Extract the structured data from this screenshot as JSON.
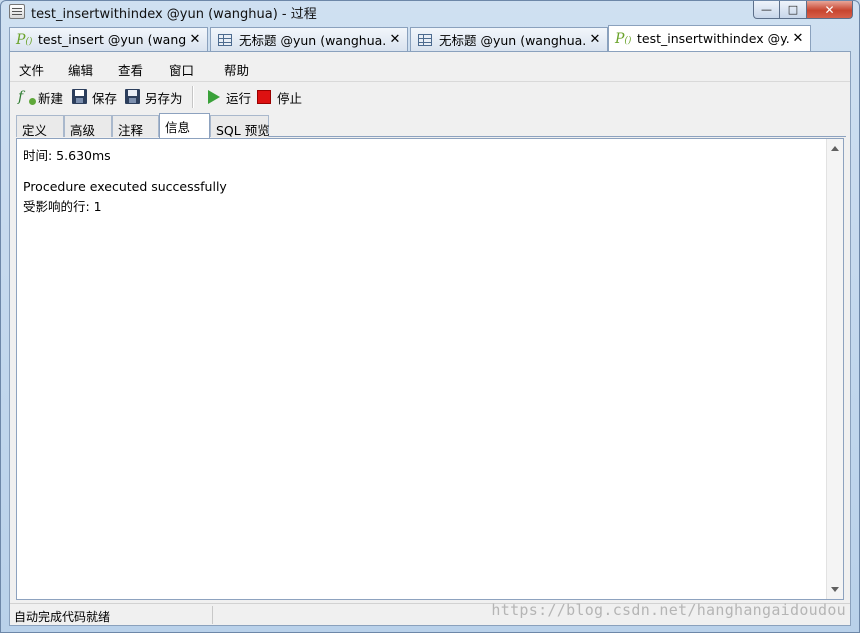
{
  "window": {
    "title": "test_insertwithindex @yun (wanghua) - 过程",
    "buttons": {
      "minimize": "—",
      "maximize": "□",
      "close": "✕"
    }
  },
  "doc_tabs": [
    {
      "label": "test_insert @yun (wang...",
      "icon": "procedure-icon",
      "close": "✕",
      "active": false
    },
    {
      "label": "无标题 @yun (wanghua...",
      "icon": "table-icon",
      "close": "✕",
      "active": false
    },
    {
      "label": "无标题 @yun (wanghua...",
      "icon": "table-icon",
      "close": "✕",
      "active": false
    },
    {
      "label": "test_insertwithindex @y...",
      "icon": "procedure-icon",
      "close": "✕",
      "active": true
    }
  ],
  "menu": [
    "文件",
    "编辑",
    "查看",
    "窗口",
    "帮助"
  ],
  "toolbar": {
    "new_label": "新建",
    "save_label": "保存",
    "saveas_label": "另存为",
    "run_label": "运行",
    "stop_label": "停止"
  },
  "inner_tabs": [
    {
      "label": "定义",
      "active": false
    },
    {
      "label": "高级",
      "active": false
    },
    {
      "label": "注释",
      "active": false
    },
    {
      "label": "信息",
      "active": true
    },
    {
      "label": "SQL 预览",
      "active": false
    }
  ],
  "content": {
    "lines": [
      "时间: 5.630ms",
      "",
      "Procedure executed successfully",
      "受影响的行: 1"
    ]
  },
  "status": {
    "text": "自动完成代码就绪"
  },
  "watermark": "https://blog.csdn.net/hanghangaidoudou",
  "colors": {
    "procedure_icon": "#6aa32a",
    "run_green": "#3aa13a",
    "stop_red": "#dd1111",
    "close_red": "#c7452f"
  }
}
